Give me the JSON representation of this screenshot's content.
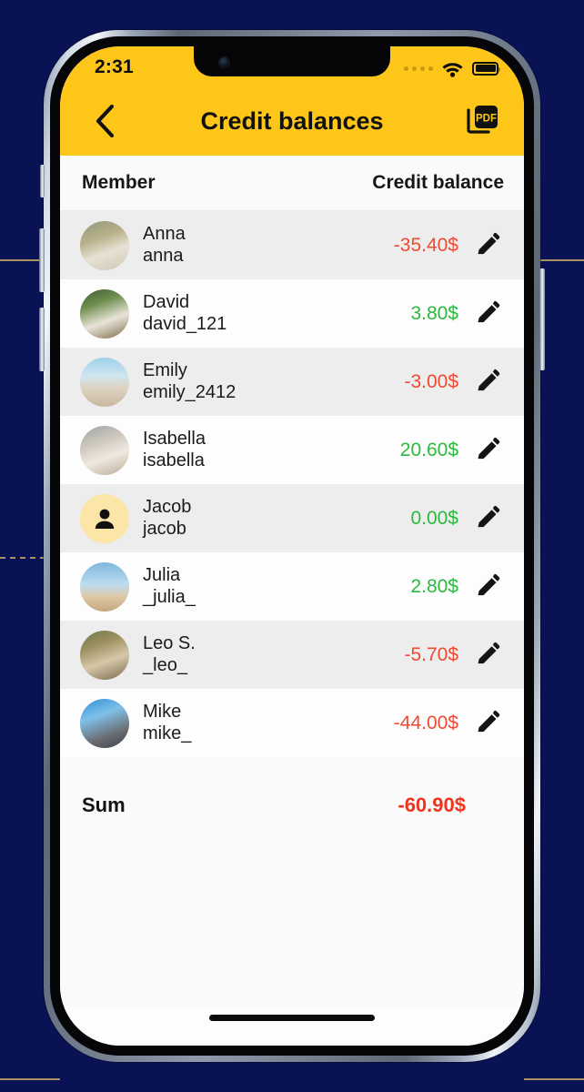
{
  "background": {
    "color": "#0a1256",
    "accent_line_color": "#c8a860"
  },
  "device": {
    "frame_color": "#8e9aab",
    "bezel_color": "#060608"
  },
  "status_bar": {
    "time": "2:31",
    "cellular_icon": "signal-dots-icon",
    "wifi_icon": "wifi-icon",
    "battery_icon": "battery-full-icon"
  },
  "nav_bar": {
    "background": "#FFC61A",
    "back_icon": "chevron-left-icon",
    "title": "Credit balances",
    "pdf_label": "PDF",
    "pdf_icon": "pdf-export-icon"
  },
  "table": {
    "headers": {
      "member": "Member",
      "balance": "Credit balance"
    },
    "rows": [
      {
        "name": "Anna",
        "handle": "anna",
        "amount": "-35.40$",
        "sign": "neg",
        "avatar": "photo",
        "edit_icon": "pencil-icon"
      },
      {
        "name": "David",
        "handle": "david_121",
        "amount": "3.80$",
        "sign": "pos",
        "avatar": "photo",
        "edit_icon": "pencil-icon"
      },
      {
        "name": "Emily",
        "handle": "emily_2412",
        "amount": "-3.00$",
        "sign": "neg",
        "avatar": "photo",
        "edit_icon": "pencil-icon"
      },
      {
        "name": "Isabella",
        "handle": "isabella",
        "amount": "20.60$",
        "sign": "pos",
        "avatar": "photo",
        "edit_icon": "pencil-icon"
      },
      {
        "name": "Jacob",
        "handle": "jacob",
        "amount": "0.00$",
        "sign": "pos",
        "avatar": "placeholder",
        "edit_icon": "pencil-icon"
      },
      {
        "name": "Julia",
        "handle": "_julia_",
        "amount": "2.80$",
        "sign": "pos",
        "avatar": "photo",
        "edit_icon": "pencil-icon"
      },
      {
        "name": "Leo S.",
        "handle": "_leo_",
        "amount": "-5.70$",
        "sign": "neg",
        "avatar": "photo",
        "edit_icon": "pencil-icon"
      },
      {
        "name": "Mike",
        "handle": "mike_",
        "amount": "-44.00$",
        "sign": "neg",
        "avatar": "photo",
        "edit_icon": "pencil-icon"
      }
    ],
    "summary": {
      "label": "Sum",
      "value": "-60.90$",
      "sign": "neg"
    }
  },
  "colors": {
    "brand_yellow": "#FFC61A",
    "negative": "#F04A33",
    "positive": "#2BBA3E",
    "sum_negative": "#F0341B",
    "row_alt": "#EDEDED",
    "row_base": "#FDFDFD"
  },
  "home_indicator": "home-indicator-bar"
}
